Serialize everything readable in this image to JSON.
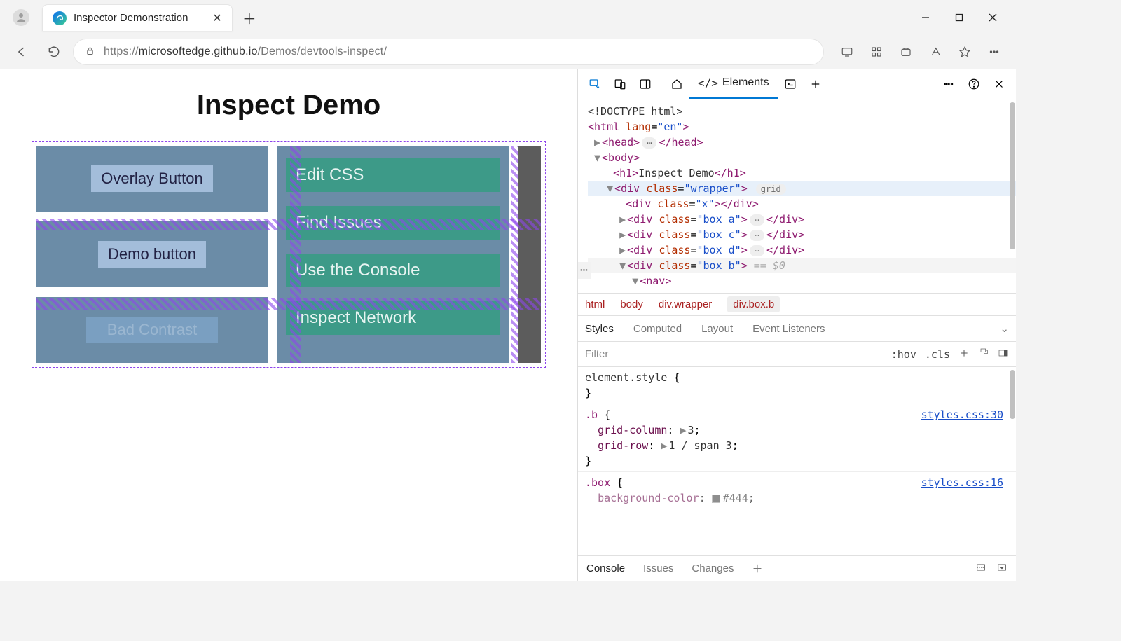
{
  "browser": {
    "tab_title": "Inspector Demonstration",
    "url_prefix": "https://",
    "url_host": "microsoftedge.github.io",
    "url_path": "/Demos/devtools-inspect/"
  },
  "page": {
    "heading": "Inspect Demo",
    "box_a_btn": "Overlay Button",
    "box_c_btn": "Demo button",
    "box_d_btn": "Bad Contrast",
    "nav_items": [
      "Edit CSS",
      "Find Issues",
      "Use the Console",
      "Inspect Network"
    ]
  },
  "devtools": {
    "main_tab": "Elements",
    "dom": {
      "doctype": "<!DOCTYPE html>",
      "html_open": "<html lang=\"en\">",
      "head": "head",
      "body": "body",
      "h1_text": "Inspect Demo",
      "wrapper_class": "wrapper",
      "grid_badge": "grid",
      "x_class": "x",
      "box_a": "box a",
      "box_c": "box c",
      "box_d": "box d",
      "box_b": "box b",
      "eq0": "== $0",
      "nav": "nav"
    },
    "crumbs": [
      "html",
      "body",
      "div.wrapper",
      "div.box.b"
    ],
    "style_tabs": [
      "Styles",
      "Computed",
      "Layout",
      "Event Listeners"
    ],
    "filter_placeholder": "Filter",
    "hov": ":hov",
    "cls": ".cls",
    "rules": {
      "r0_sel": "element.style",
      "r1_sel": ".b",
      "r1_link": "styles.css:30",
      "r1_p1": "grid-column",
      "r1_v1": "3",
      "r1_p2": "grid-row",
      "r1_v2": "1 / span 3",
      "r2_sel": ".box",
      "r2_link": "styles.css:16",
      "r2_p1": "background-color",
      "r2_v1": "#444"
    },
    "drawer_tabs": [
      "Console",
      "Issues",
      "Changes"
    ]
  }
}
